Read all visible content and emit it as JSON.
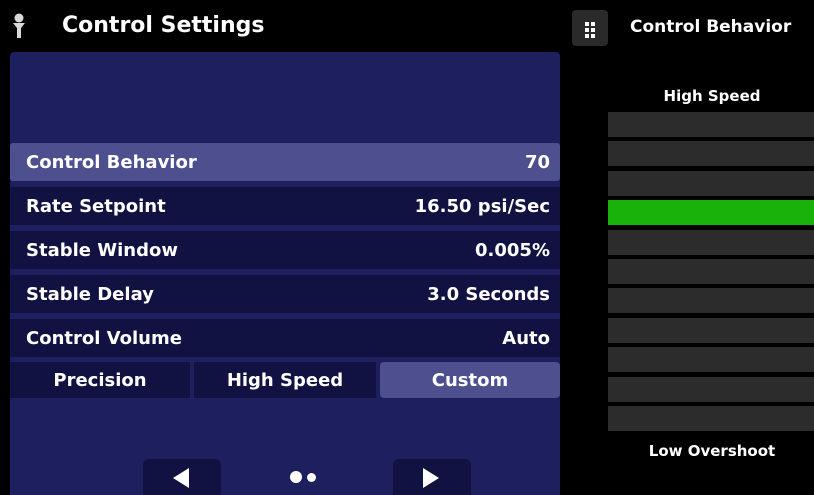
{
  "header": {
    "title": "Control Settings",
    "logo_icon": "probe-icon"
  },
  "settings": [
    {
      "label": "Control Behavior",
      "value": "70",
      "selected": true
    },
    {
      "label": "Rate Setpoint",
      "value": "16.50 psi/Sec",
      "selected": false
    },
    {
      "label": "Stable Window",
      "value": "0.005%",
      "selected": false
    },
    {
      "label": "Stable Delay",
      "value": "3.0 Seconds",
      "selected": false
    },
    {
      "label": "Control Volume",
      "value": "Auto",
      "selected": false
    }
  ],
  "modes": [
    {
      "label": "Precision",
      "active": false
    },
    {
      "label": "High Speed",
      "active": false
    },
    {
      "label": "Custom",
      "active": true
    }
  ],
  "nav": {
    "prev_icon": "left-arrow-icon",
    "next_icon": "right-arrow-icon",
    "page": 1,
    "pages": 2
  },
  "side_panel": {
    "menu_icon": "grip-icon",
    "title": "Control Behavior",
    "top_label": "High Speed",
    "bottom_label": "Low Overshoot",
    "bar_count": 11,
    "selected_index": 3
  },
  "colors": {
    "panel": "#1e1f5e",
    "row": "#111241",
    "selected": "#4d4f8e",
    "slider_active": "#19b20a",
    "slider_idle": "#2c2c2c"
  }
}
